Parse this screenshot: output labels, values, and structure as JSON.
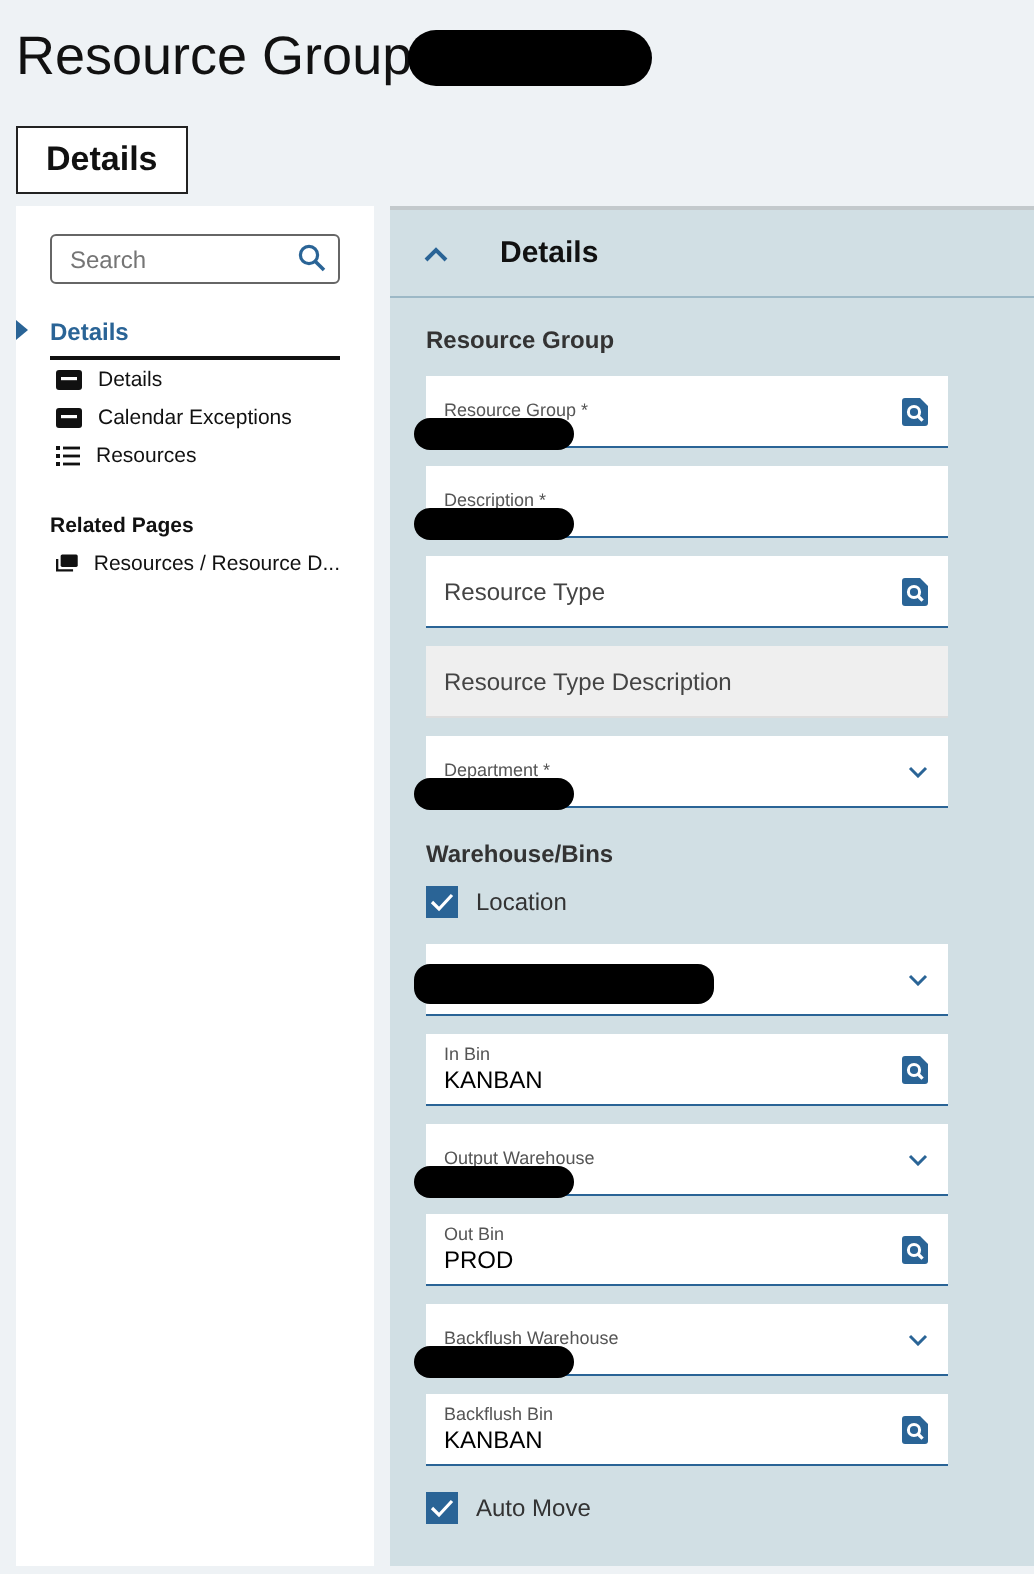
{
  "page_title": {
    "text": "Resource Group",
    "redacted": true
  },
  "tabs": [
    {
      "label": "Details",
      "selected": true
    }
  ],
  "sidebar": {
    "search": {
      "placeholder": "Search"
    },
    "sections": [
      {
        "label": "Details",
        "selected": true,
        "items": [
          {
            "label": "Details",
            "kind": "card"
          },
          {
            "label": "Calendar Exceptions",
            "kind": "card"
          },
          {
            "label": "Resources",
            "kind": "list"
          }
        ]
      }
    ],
    "related_pages": {
      "title": "Related Pages",
      "items": [
        {
          "label": "Resources / Resource D...",
          "kind": "stack"
        }
      ]
    }
  },
  "panel": {
    "title": "Details",
    "expanded": true,
    "groups": [
      {
        "title": "Resource Group",
        "rows": [
          {
            "kind": "lookup",
            "label": "Resource Group *",
            "redacted": true
          },
          {
            "kind": "text",
            "label": "Description *",
            "redacted": true
          },
          {
            "kind": "lookup",
            "label": "Resource Type",
            "redacted": false
          },
          {
            "kind": "readonly",
            "label": "Resource Type Description",
            "redacted": false
          },
          {
            "kind": "select",
            "label": "Department *",
            "redacted": true
          }
        ]
      },
      {
        "title": "Warehouse/Bins",
        "rows": [
          {
            "kind": "checkbox",
            "label": "Location",
            "checked": true
          },
          {
            "kind": "select",
            "redacted": true
          },
          {
            "kind": "lookup",
            "label": "In Bin",
            "value": "KANBAN",
            "redacted": false
          },
          {
            "kind": "select",
            "label": "Output Warehouse",
            "redacted": true
          },
          {
            "kind": "lookup",
            "label": "Out Bin",
            "value": "PROD",
            "redacted": false
          },
          {
            "kind": "select",
            "label": "Backflush Warehouse",
            "redacted": true
          },
          {
            "kind": "lookup",
            "label": "Backflush Bin",
            "value": "KANBAN",
            "redacted": false
          },
          {
            "kind": "checkbox",
            "label": "Auto Move",
            "checked": true
          }
        ]
      }
    ]
  }
}
